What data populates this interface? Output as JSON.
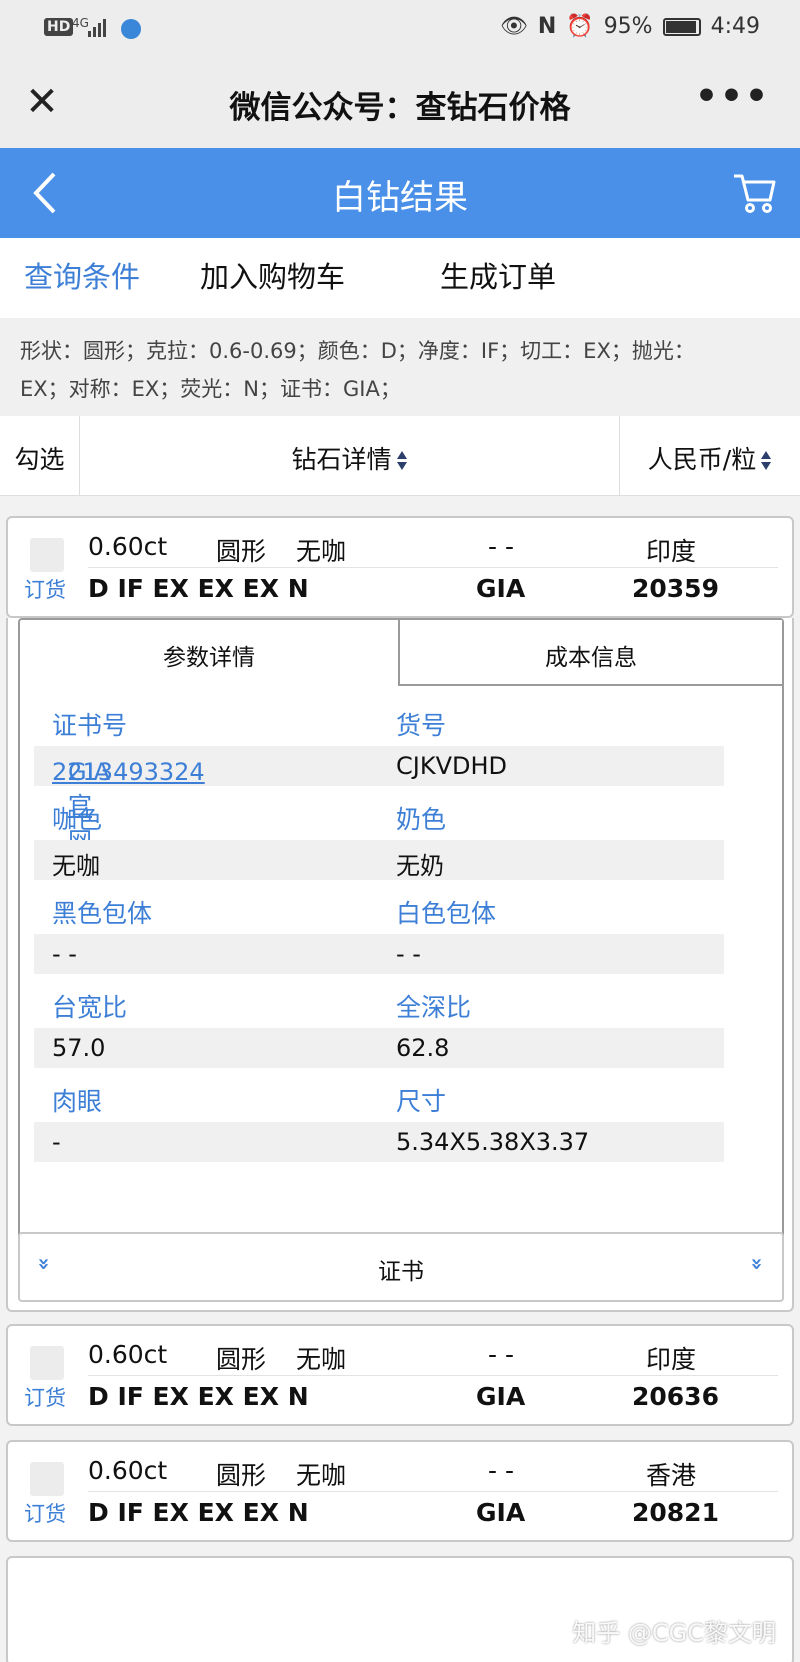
{
  "status_bar": {
    "hd": "HD",
    "signal": "4G",
    "battery": "95%",
    "time": "4:49"
  },
  "wechat": {
    "close_icon": "close-icon",
    "title": "微信公众号：查钻石价格",
    "more": "•••"
  },
  "header": {
    "title": "白钻结果"
  },
  "actions": {
    "query": "查询条件",
    "add_cart": "加入购物车",
    "create_order": "生成订单"
  },
  "conditions": {
    "line1": "形状：圆形；克拉：0.6-0.69；颜色：D；净度：IF；切工：EX；抛光：",
    "line2": "EX；对称：EX；荧光：N；证书：GIA；"
  },
  "table_header": {
    "select": "勾选",
    "details": "钻石详情",
    "price": "人民币/粒"
  },
  "items": [
    {
      "order_label": "订货",
      "carat": "0.60ct",
      "shape": "圆形",
      "brown": "无咖",
      "dash": "- -",
      "origin": "印度",
      "grade": "D IF EX EX EX N",
      "lab": "GIA",
      "price": "20359"
    },
    {
      "order_label": "订货",
      "carat": "0.60ct",
      "shape": "圆形",
      "brown": "无咖",
      "dash": "- -",
      "origin": "印度",
      "grade": "D IF EX EX EX N",
      "lab": "GIA",
      "price": "20636"
    },
    {
      "order_label": "订货",
      "carat": "0.60ct",
      "shape": "圆形",
      "brown": "无咖",
      "dash": "- -",
      "origin": "香港",
      "grade": "D IF EX EX EX N",
      "lab": "GIA",
      "price": "20821"
    }
  ],
  "detail": {
    "tab_params": "参数详情",
    "tab_cost": "成本信息",
    "cert_no_label": "证书号",
    "cert_no": "2213493324",
    "gia_link": "GIA官网",
    "stock_label": "货号",
    "stock": "CJKVDHD",
    "brown_label": "咖色",
    "brown": "无咖",
    "milky_label": "奶色",
    "milky": "无奶",
    "black_inc_label": "黑色包体",
    "black_inc": "- -",
    "white_inc_label": "白色包体",
    "white_inc": "- -",
    "table_label": "台宽比",
    "table": "57.0",
    "depth_label": "全深比",
    "depth": "62.8",
    "eye_label": "肉眼",
    "eye": "-",
    "size_label": "尺寸",
    "size": "5.34X5.38X3.37",
    "cert_bar": "证书",
    "expand": "»"
  },
  "watermark": "知乎 @CGC黎文明"
}
